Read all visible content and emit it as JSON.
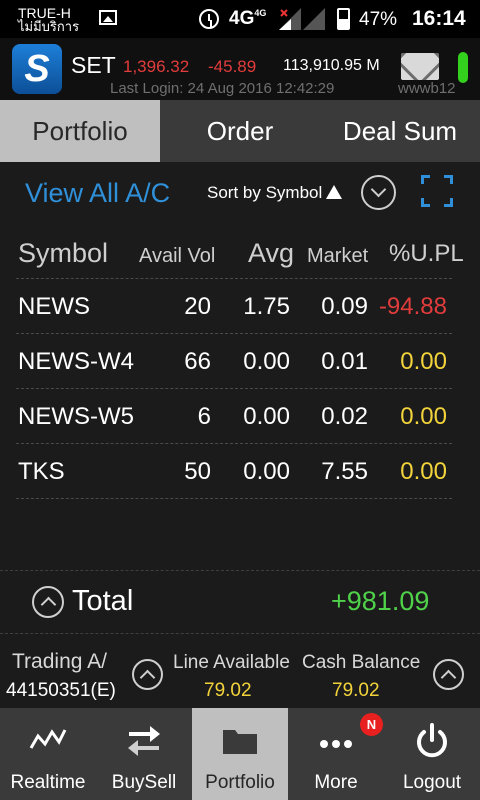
{
  "status_bar": {
    "carrier": "TRUE-H",
    "carrier_status": "ไม่มีบริการ",
    "network": "4G",
    "network_sup": "4G",
    "battery": "47%",
    "time": "16:14"
  },
  "header": {
    "logo_letter": "S",
    "market": "SET",
    "index": "1,396.32",
    "change": "-45.89",
    "value": "113,910.95 M",
    "last_login": "Last Login: 24 Aug 2016 12:42:29",
    "server": "wwwb12"
  },
  "tabs": [
    {
      "label": "Portfolio",
      "active": true
    },
    {
      "label": "Order",
      "active": false
    },
    {
      "label": "Deal Sum",
      "active": false
    }
  ],
  "toolbar": {
    "view_all": "View All A/C",
    "sort_label": "Sort by Symbol"
  },
  "table": {
    "headers": {
      "symbol": "Symbol",
      "avail_vol": "Avail Vol",
      "avg": "Avg",
      "market": "Market",
      "upl": "%U.PL"
    },
    "rows": [
      {
        "symbol": "NEWS",
        "avail_vol": "20",
        "avg": "1.75",
        "market": "0.09",
        "upl": "-94.88",
        "upl_color": "#e03c3c"
      },
      {
        "symbol": "NEWS-W4",
        "avail_vol": "66",
        "avg": "0.00",
        "market": "0.01",
        "upl": "0.00",
        "upl_color": "#f2d33b"
      },
      {
        "symbol": "NEWS-W5",
        "avail_vol": "6",
        "avg": "0.00",
        "market": "0.02",
        "upl": "0.00",
        "upl_color": "#f2d33b"
      },
      {
        "symbol": "TKS",
        "avail_vol": "50",
        "avg": "0.00",
        "market": "7.55",
        "upl": "0.00",
        "upl_color": "#f2d33b"
      }
    ]
  },
  "total": {
    "label": "Total",
    "value": "+981.09",
    "color": "#50d14a"
  },
  "account": {
    "label": "Trading A/",
    "number": "44150351(E)",
    "line_available_label": "Line Available",
    "line_available": "79.02",
    "cash_balance_label": "Cash Balance",
    "cash_balance": "79.02"
  },
  "bottom_nav": [
    {
      "label": "Realtime",
      "icon": "chart-line-icon",
      "active": false
    },
    {
      "label": "BuySell",
      "icon": "buy-sell-arrows-icon",
      "active": false
    },
    {
      "label": "Portfolio",
      "icon": "folder-icon",
      "active": true
    },
    {
      "label": "More",
      "icon": "more-dots-icon",
      "active": false,
      "badge": "N"
    },
    {
      "label": "Logout",
      "icon": "power-icon",
      "active": false
    }
  ]
}
